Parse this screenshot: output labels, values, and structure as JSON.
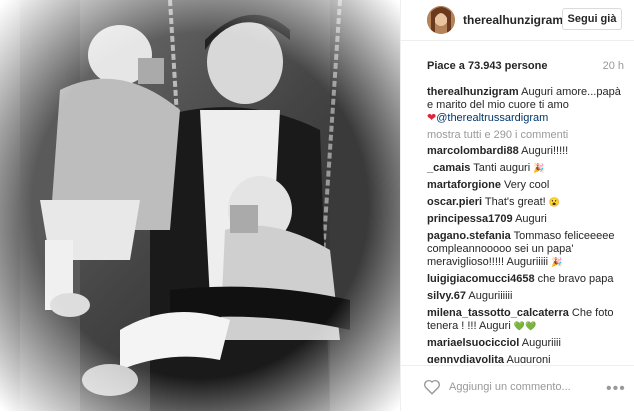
{
  "post": {
    "username": "therealhunzigram",
    "follow_label": "Segui già",
    "likes": "Piace a 73.943 persone",
    "time": "20 h",
    "caption_user": "therealhunzigram",
    "caption_text": "Auguri amore...papà e marito del mio cuore ti amo",
    "caption_mention": "@therealtrussardigram",
    "view_all": "mostra tutti e 290 i commenti",
    "add_placeholder": "Aggiungi un commento..."
  },
  "comments": [
    {
      "user": "marcolombardi88",
      "text": "Auguri!!!!!"
    },
    {
      "user": "_camais",
      "text": "Tanti auguri"
    },
    {
      "user": "martaforgione",
      "text": "Very cool"
    },
    {
      "user": "oscar.pieri",
      "text": "That's great!"
    },
    {
      "user": "principessa1709",
      "text": "Auguri"
    },
    {
      "user": "pagano.stefania",
      "text": "Tommaso feliceeeee compleannooooo sei un papa' meraviglioso!!!!! Auguriiiii"
    },
    {
      "user": "luigigiacomucci4658",
      "text": "che bravo papa"
    },
    {
      "user": "silvy.67",
      "text": "Auguriiiiii"
    },
    {
      "user": "milena_tassotto_calcaterra",
      "text": "Che foto tenera ! !!! Auguri"
    },
    {
      "user": "mariaelsuocicciol",
      "text": "Auguriiii"
    },
    {
      "user": "gennydiavolita",
      "text": "Auguroni"
    }
  ],
  "icons": {
    "heart": "heart-outline-icon",
    "more": "more-dots-icon",
    "love": "red-heart-icon"
  },
  "colors": {
    "link": "#003569",
    "muted": "#999999",
    "heart": "#e0243a"
  }
}
